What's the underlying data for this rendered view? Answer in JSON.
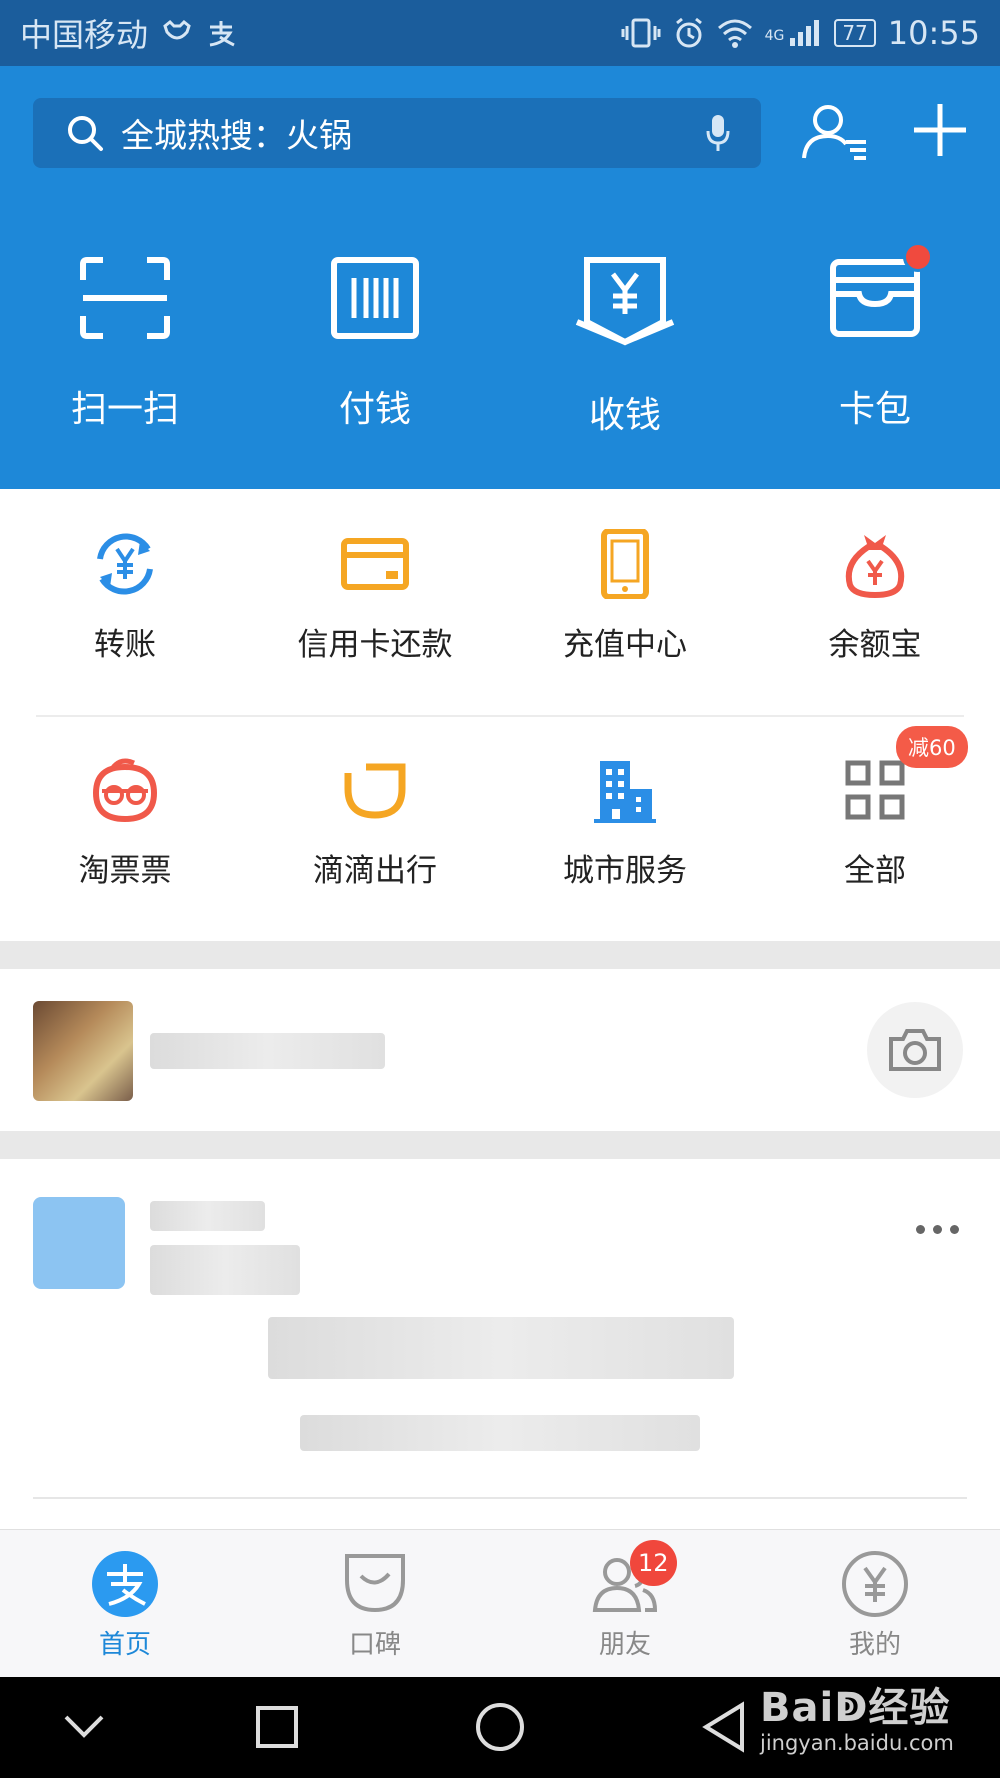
{
  "status_bar": {
    "carrier": "中国移动",
    "network": "4G",
    "battery": "77",
    "time": "10:55"
  },
  "header": {
    "search_placeholder": "全城热搜：火锅"
  },
  "top_actions": [
    {
      "label": "扫一扫",
      "icon": "scan-icon"
    },
    {
      "label": "付钱",
      "icon": "barcode-icon"
    },
    {
      "label": "收钱",
      "icon": "receive-money-icon"
    },
    {
      "label": "卡包",
      "icon": "card-wallet-icon"
    }
  ],
  "services_row1": [
    {
      "label": "转账",
      "icon": "transfer-icon",
      "color": "#2b8ee6"
    },
    {
      "label": "信用卡还款",
      "icon": "credit-card-icon",
      "color": "#f5a623"
    },
    {
      "label": "充值中心",
      "icon": "phone-topup-icon",
      "color": "#f5a623"
    },
    {
      "label": "余额宝",
      "icon": "money-bag-icon",
      "color": "#f0594a"
    }
  ],
  "services_row2": [
    {
      "label": "淘票票",
      "icon": "taopiaopiao-icon",
      "color": "#f0594a"
    },
    {
      "label": "滴滴出行",
      "icon": "didi-icon",
      "color": "#f5a623"
    },
    {
      "label": "城市服务",
      "icon": "city-building-icon",
      "color": "#2b8ee6"
    },
    {
      "label": "全部",
      "icon": "grid-all-icon",
      "color": "#777777"
    }
  ],
  "all_badge": "减60",
  "tabs": [
    {
      "label": "首页",
      "icon": "alipay-home-icon",
      "active": true
    },
    {
      "label": "口碑",
      "icon": "koubei-icon",
      "active": false
    },
    {
      "label": "朋友",
      "icon": "friends-icon",
      "active": false,
      "badge": "12"
    },
    {
      "label": "我的",
      "icon": "yuan-circle-icon",
      "active": false
    }
  ],
  "watermark": {
    "main": "Baiↁ经验",
    "sub": "jingyan.baidu.com"
  },
  "colors": {
    "header_blue": "#1e88d8",
    "status_blue": "#1b5d9c",
    "accent_red": "#f0473c"
  }
}
